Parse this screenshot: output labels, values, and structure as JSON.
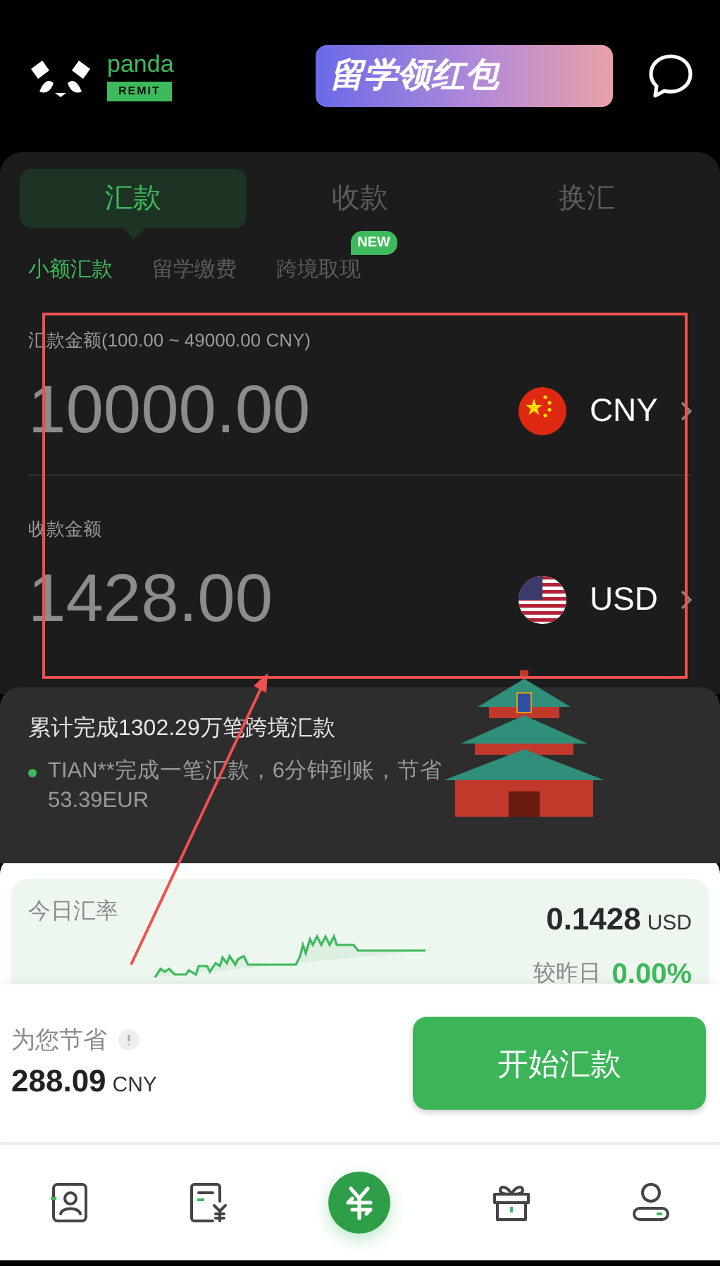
{
  "logo": {
    "name": "panda",
    "tag": "REMIT"
  },
  "banner": {
    "text": "留学领红包"
  },
  "tabs": [
    {
      "label": "汇款",
      "selected": true
    },
    {
      "label": "收款",
      "selected": false
    },
    {
      "label": "换汇",
      "selected": false
    }
  ],
  "subtabs": [
    {
      "label": "小额汇款",
      "selected": true
    },
    {
      "label": "留学缴费",
      "selected": false
    },
    {
      "label": "跨境取现",
      "selected": false,
      "badge": "NEW"
    }
  ],
  "send": {
    "label": "汇款金额(100.00 ~ 49000.00 CNY)",
    "amount": "10000.00",
    "currency": "CNY",
    "flag": {
      "kind": "cn"
    }
  },
  "receive": {
    "label": "收款金额",
    "amount": "1428.00",
    "currency": "USD",
    "flag": {
      "kind": "us"
    }
  },
  "ticker": {
    "title": "累计完成1302.29万笔跨境汇款",
    "message": "TIAN**完成一笔汇款，6分钟到账，节省53.39EUR"
  },
  "rate": {
    "label": "今日汇率",
    "value": "0.1428",
    "currency": "USD",
    "change_label": "较昨日",
    "change": "0.00%"
  },
  "savings": {
    "label": "为您节省",
    "amount": "288.09",
    "currency": "CNY"
  },
  "action": {
    "label": "开始汇款"
  },
  "nav": [
    {
      "kind": "contacts",
      "selected": false
    },
    {
      "kind": "bill",
      "selected": false
    },
    {
      "kind": "transfer",
      "selected": true
    },
    {
      "kind": "gift",
      "selected": false
    },
    {
      "kind": "profile",
      "selected": false
    }
  ]
}
